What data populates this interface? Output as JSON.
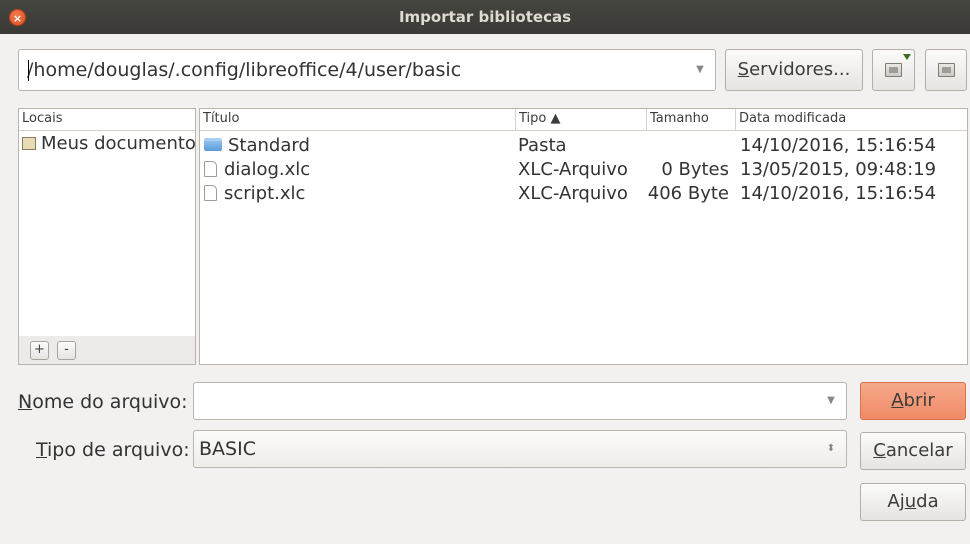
{
  "window": {
    "title": "Importar bibliotecas",
    "close_glyph": "×"
  },
  "location": {
    "path": "/home/douglas/.config/libreoffice/4/user/basic",
    "dropdown_icon": "chevron-down-icon",
    "dropdown_glyph": "▼"
  },
  "toolbar": {
    "servers_prefix": "",
    "servers_mnemonic": "S",
    "servers_rest": "ervidores...",
    "new_folder_icon": "new-folder-icon",
    "up_folder_icon": "parent-folder-icon"
  },
  "places": {
    "header": "Locais",
    "items": [
      {
        "label": "Meus documentos",
        "icon": "home-folder-icon"
      }
    ],
    "add_glyph": "+",
    "remove_glyph": "-"
  },
  "files": {
    "columns": {
      "title": "Título",
      "type": "Tipo ▲",
      "size": "Tamanho",
      "date": "Data modificada"
    },
    "rows": [
      {
        "title": "Standard",
        "type": "Pasta",
        "size": "",
        "date": "14/10/2016, 15:16:54",
        "icon": "folder-icon"
      },
      {
        "title": "dialog.xlc",
        "type": "XLC-Arquivo",
        "size": "0 Bytes",
        "date": "13/05/2015, 09:48:19",
        "icon": "file-icon"
      },
      {
        "title": "script.xlc",
        "type": "XLC-Arquivo",
        "size": "406 Byte",
        "date": "14/10/2016, 15:16:54",
        "icon": "file-icon"
      }
    ]
  },
  "filename": {
    "label_mnemonic": "N",
    "label_rest": "ome do arquivo:",
    "value": "",
    "dropdown_glyph": "▼"
  },
  "filetype": {
    "label_mnemonic": "T",
    "label_rest": "ipo de arquivo:",
    "value": "BASIC",
    "spinner_glyph": "⬍"
  },
  "buttons": {
    "open_mnemonic": "A",
    "open_rest": "brir",
    "cancel_mnemonic": "C",
    "cancel_rest": "ancelar",
    "help_prefix": "Aj",
    "help_mnemonic": "u",
    "help_rest": "da"
  },
  "colors": {
    "accent": "#f08a66",
    "titlebar": "#3b3a36",
    "background": "#f2f1f0"
  }
}
